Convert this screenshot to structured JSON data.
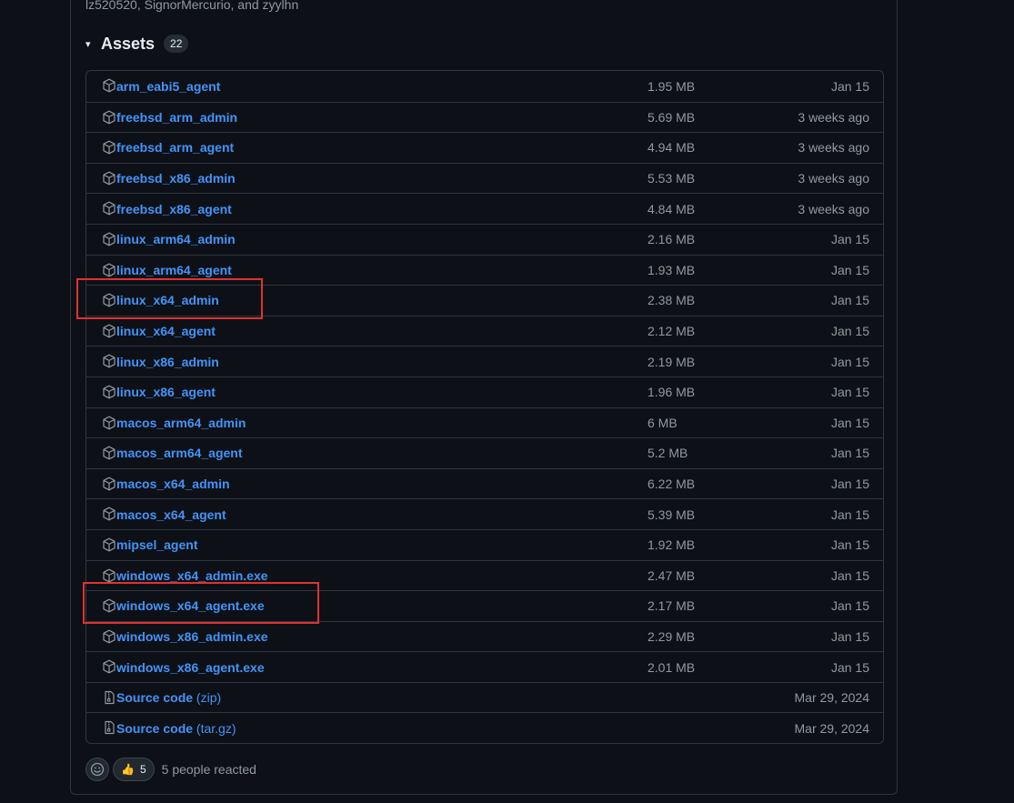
{
  "contributors_text": "lz520520, SignorMercurio, and zyylhn",
  "assets": {
    "caret": "▾",
    "title": "Assets",
    "count": "22",
    "items": [
      {
        "name": "arm_eabi5_agent",
        "suffix": "",
        "size": "1.95 MB",
        "date": "Jan 15",
        "icon": "package-icon"
      },
      {
        "name": "freebsd_arm_admin",
        "suffix": "",
        "size": "5.69 MB",
        "date": "3 weeks ago",
        "icon": "package-icon"
      },
      {
        "name": "freebsd_arm_agent",
        "suffix": "",
        "size": "4.94 MB",
        "date": "3 weeks ago",
        "icon": "package-icon"
      },
      {
        "name": "freebsd_x86_admin",
        "suffix": "",
        "size": "5.53 MB",
        "date": "3 weeks ago",
        "icon": "package-icon"
      },
      {
        "name": "freebsd_x86_agent",
        "suffix": "",
        "size": "4.84 MB",
        "date": "3 weeks ago",
        "icon": "package-icon"
      },
      {
        "name": "linux_arm64_admin",
        "suffix": "",
        "size": "2.16 MB",
        "date": "Jan 15",
        "icon": "package-icon"
      },
      {
        "name": "linux_arm64_agent",
        "suffix": "",
        "size": "1.93 MB",
        "date": "Jan 15",
        "icon": "package-icon"
      },
      {
        "name": "linux_x64_admin",
        "suffix": "",
        "size": "2.38 MB",
        "date": "Jan 15",
        "icon": "package-icon"
      },
      {
        "name": "linux_x64_agent",
        "suffix": "",
        "size": "2.12 MB",
        "date": "Jan 15",
        "icon": "package-icon"
      },
      {
        "name": "linux_x86_admin",
        "suffix": "",
        "size": "2.19 MB",
        "date": "Jan 15",
        "icon": "package-icon"
      },
      {
        "name": "linux_x86_agent",
        "suffix": "",
        "size": "1.96 MB",
        "date": "Jan 15",
        "icon": "package-icon"
      },
      {
        "name": "macos_arm64_admin",
        "suffix": "",
        "size": "6 MB",
        "date": "Jan 15",
        "icon": "package-icon"
      },
      {
        "name": "macos_arm64_agent",
        "suffix": "",
        "size": "5.2 MB",
        "date": "Jan 15",
        "icon": "package-icon"
      },
      {
        "name": "macos_x64_admin",
        "suffix": "",
        "size": "6.22 MB",
        "date": "Jan 15",
        "icon": "package-icon"
      },
      {
        "name": "macos_x64_agent",
        "suffix": "",
        "size": "5.39 MB",
        "date": "Jan 15",
        "icon": "package-icon"
      },
      {
        "name": "mipsel_agent",
        "suffix": "",
        "size": "1.92 MB",
        "date": "Jan 15",
        "icon": "package-icon"
      },
      {
        "name": "windows_x64_admin.exe",
        "suffix": "",
        "size": "2.47 MB",
        "date": "Jan 15",
        "icon": "package-icon"
      },
      {
        "name": "windows_x64_agent.exe",
        "suffix": "",
        "size": "2.17 MB",
        "date": "Jan 15",
        "icon": "package-icon"
      },
      {
        "name": "windows_x86_admin.exe",
        "suffix": "",
        "size": "2.29 MB",
        "date": "Jan 15",
        "icon": "package-icon"
      },
      {
        "name": "windows_x86_agent.exe",
        "suffix": "",
        "size": "2.01 MB",
        "date": "Jan 15",
        "icon": "package-icon"
      },
      {
        "name": "Source code",
        "suffix": " (zip)",
        "size": "",
        "date": "Mar 29, 2024",
        "icon": "file-zip-icon"
      },
      {
        "name": "Source code",
        "suffix": " (tar.gz)",
        "size": "",
        "date": "Mar 29, 2024",
        "icon": "file-zip-icon"
      }
    ]
  },
  "reactions": {
    "emoji": "👍",
    "count": "5",
    "summary": "5 people reacted"
  },
  "colors": {
    "background": "#0d1117",
    "link": "#4493f8",
    "muted": "#9198a1",
    "border": "#30363d",
    "highlight": "#e03131"
  }
}
